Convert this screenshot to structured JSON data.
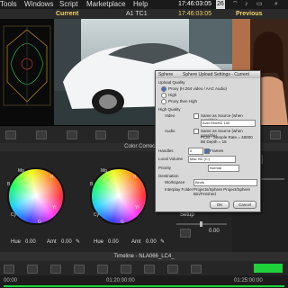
{
  "menubar": {
    "items": [
      "Tools",
      "Windows",
      "Script",
      "Marketplace",
      "Help"
    ],
    "status": "17:46:03:05",
    "extra": "26"
  },
  "monitor": {
    "current_label": "Current",
    "track_label": "A1  TC1",
    "timecode": "17:46:03:05",
    "previous_label": "Previous"
  },
  "color_correction": {
    "title": "Color Correction",
    "wheels": [
      {
        "hue_label": "Hue",
        "hue_value": "0.00",
        "amt_label": "Amt",
        "amt_value": "0.00",
        "marks": [
          "Mg",
          "R",
          "Yl",
          "G",
          "Cy",
          "B"
        ]
      },
      {
        "hue_label": "Hue",
        "hue_value": "0.00",
        "amt_label": "Amt",
        "amt_value": "0.00",
        "marks": [
          "Mg",
          "R",
          "Yl",
          "G",
          "Cy",
          "B"
        ]
      }
    ],
    "setup_label": "Setup",
    "setup_value": "0.00"
  },
  "timeline": {
    "title": "Timeline - NLA066_LC4_",
    "ruler": [
      "00:00",
      "01:20:00:00",
      "01:25:00:00"
    ]
  },
  "dialog": {
    "title_left": "Sphere",
    "title": "Sphere Upload Settings - Current",
    "upload_quality_label": "Upload Quality",
    "options": [
      "Proxy (H.264 video / AAC Audio)",
      "High",
      "Proxy then High"
    ],
    "high_quality_label": "High Quality",
    "video_label": "Video",
    "video_value": "Same as Source (when possible)",
    "codec_value": "Avid DNxHD 145",
    "audio_label": "Audio",
    "audio_value": "Same as Source (when possible)",
    "audio_format": "PCM - Sample Rate = 48000  Bit Depth = 16",
    "handles_label": "Handles",
    "handles_value": "0",
    "frames_label": "Frames",
    "local_volume_label": "Local Volume",
    "local_volume_value": "Mac HD (C:)",
    "priority_label": "Priority",
    "priority_value": "Normal",
    "destination_label": "Destination",
    "workspace_label": "Workspace",
    "workspace_value": "Binds",
    "interplay_label": "Interplay Folder",
    "interplay_value": "Projects/Sphere Project/Sphere Bin/Finished",
    "ok_label": "OK",
    "cancel_label": "Cancel"
  },
  "colors": {
    "accent_green": "#1fd23c",
    "timecode_yellow": "#f5d36b",
    "dialog_bg": "#d8d8d8"
  }
}
